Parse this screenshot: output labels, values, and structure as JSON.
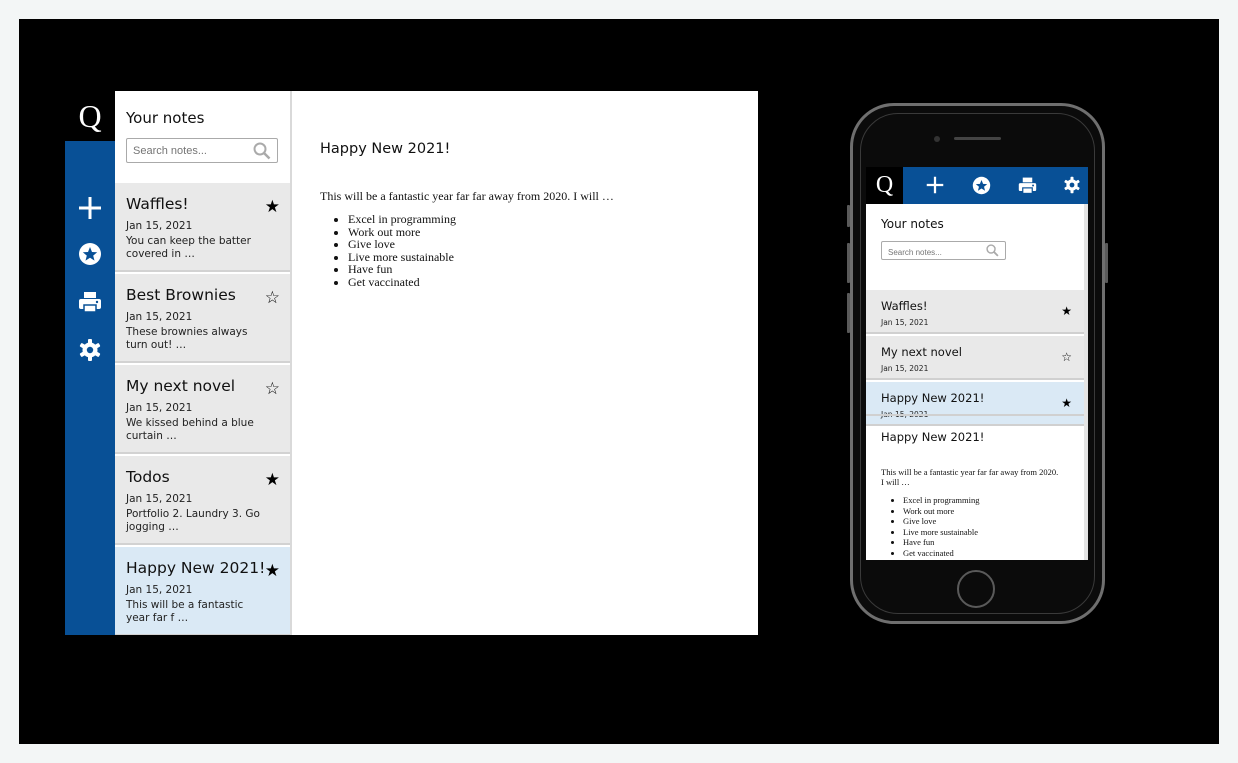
{
  "app": {
    "logo": "Q"
  },
  "sidebar_icons": [
    {
      "name": "plus-icon",
      "label": "+"
    },
    {
      "name": "star-circle-icon"
    },
    {
      "name": "print-icon"
    },
    {
      "name": "gear-icon"
    }
  ],
  "list": {
    "title": "Your notes",
    "search_placeholder": "Search notes..."
  },
  "notes": [
    {
      "title": "Waffles!",
      "date": "Jan 15, 2021",
      "preview": "You can keep the batter covered in …",
      "starred": true,
      "star": "★"
    },
    {
      "title": "Best Brownies",
      "date": "Jan 15, 2021",
      "preview": "These brownies always turn out! …",
      "starred": false,
      "star": "☆"
    },
    {
      "title": "My next novel",
      "date": "Jan 15, 2021",
      "preview": "We kissed behind a blue curtain …",
      "starred": false,
      "star": "☆"
    },
    {
      "title": "Todos",
      "date": "Jan 15, 2021",
      "preview": "Portfolio 2. Laundry 3. Go jogging …",
      "starred": true,
      "star": "★"
    },
    {
      "title": "Happy New 2021!",
      "date": "Jan 15, 2021",
      "preview": "This will be a fantastic year far f …",
      "starred": true,
      "star": "★",
      "active": true
    }
  ],
  "editor": {
    "title": "Happy New 2021!",
    "intro": "This will be a fantastic year far far away from 2020. I will …",
    "items": [
      "Excel in programming",
      "Work out more",
      "Give love",
      "Live more sustainable",
      "Have fun",
      "Get vaccinated"
    ]
  },
  "mobile": {
    "logo": "Q",
    "list_title": "Your notes",
    "search_placeholder": "Search notes...",
    "notes": [
      {
        "title": "Waffles!",
        "date": "Jan 15, 2021",
        "star": "★"
      },
      {
        "title": "My next novel",
        "date": "Jan 15, 2021",
        "star": "☆"
      },
      {
        "title": "Happy New 2021!",
        "date": "Jan 15, 2021",
        "star": "★",
        "active": true
      }
    ],
    "editor": {
      "title": "Happy New 2021!",
      "intro": "This will be a fantastic year far far away from 2020. I will …",
      "items": [
        "Excel in programming",
        "Work out more",
        "Give love",
        "Live more sustainable",
        "Have fun",
        "Get vaccinated"
      ]
    }
  },
  "colors": {
    "brand_blue": "#085096",
    "active_note": "#dae9f5",
    "note_bg": "#e9e9e9",
    "stage": "#000000"
  }
}
